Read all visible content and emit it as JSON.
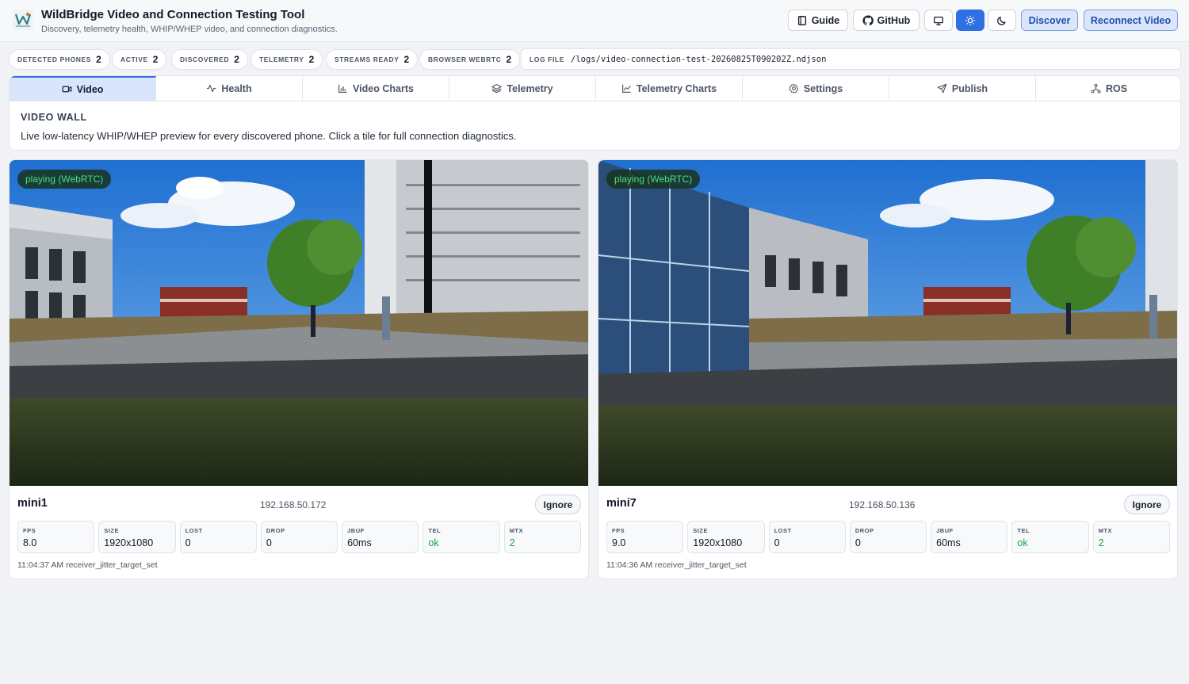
{
  "header": {
    "title": "WildBridge Video and Connection Testing Tool",
    "subtitle": "Discovery, telemetry health, WHIP/WHEP video, and connection diagnostics.",
    "logo_icon": "wildbridge-logo-icon",
    "buttons": {
      "guide": "Guide",
      "github": "GitHub",
      "discover": "Discover",
      "reconnect": "Reconnect Video"
    },
    "theme_icons": [
      "monitor-icon",
      "sun-icon",
      "moon-icon"
    ],
    "active_theme": "light",
    "accent": "#2f6fe4"
  },
  "stats": [
    {
      "label": "DETECTED PHONES",
      "value": "2"
    },
    {
      "label": "ACTIVE",
      "value": "2"
    },
    {
      "label": "DISCOVERED",
      "value": "2"
    },
    {
      "label": "TELEMETRY",
      "value": "2"
    },
    {
      "label": "STREAMS READY",
      "value": "2"
    },
    {
      "label": "BROWSER WEBRTC",
      "value": "2"
    }
  ],
  "logfile": {
    "label": "LOG FILE",
    "path": "/logs/video-connection-test-20260825T090202Z.ndjson"
  },
  "tabs": [
    {
      "label": "Video",
      "icon": "video-icon",
      "active": true
    },
    {
      "label": "Health",
      "icon": "activity-icon",
      "active": false
    },
    {
      "label": "Video Charts",
      "icon": "bar-chart-icon",
      "active": false
    },
    {
      "label": "Telemetry",
      "icon": "layers-icon",
      "active": false
    },
    {
      "label": "Telemetry Charts",
      "icon": "line-chart-icon",
      "active": false
    },
    {
      "label": "Settings",
      "icon": "gear-icon",
      "active": false
    },
    {
      "label": "Publish",
      "icon": "send-icon",
      "active": false
    },
    {
      "label": "ROS",
      "icon": "network-icon",
      "active": false
    }
  ],
  "wall": {
    "title": "VIDEO WALL",
    "description": "Live low-latency WHIP/WHEP preview for every discovered phone. Click a tile for full connection diagnostics."
  },
  "devices": [
    {
      "name": "mini1",
      "ip": "192.168.50.172",
      "status": "playing (WebRTC)",
      "ignore": "Ignore",
      "metrics": [
        {
          "key": "FPS",
          "value": "8.0"
        },
        {
          "key": "SIZE",
          "value": "1920x1080"
        },
        {
          "key": "LOST",
          "value": "0"
        },
        {
          "key": "DROP",
          "value": "0"
        },
        {
          "key": "JBUF",
          "value": "60ms"
        },
        {
          "key": "TEL",
          "value": "ok"
        },
        {
          "key": "MTX",
          "value": "2"
        }
      ],
      "last_event": "11:04:37 AM receiver_jitter_target_set"
    },
    {
      "name": "mini7",
      "ip": "192.168.50.136",
      "status": "playing (WebRTC)",
      "ignore": "Ignore",
      "metrics": [
        {
          "key": "FPS",
          "value": "9.0"
        },
        {
          "key": "SIZE",
          "value": "1920x1080"
        },
        {
          "key": "LOST",
          "value": "0"
        },
        {
          "key": "DROP",
          "value": "0"
        },
        {
          "key": "JBUF",
          "value": "60ms"
        },
        {
          "key": "TEL",
          "value": "ok"
        },
        {
          "key": "MTX",
          "value": "2"
        }
      ],
      "last_event": "11:04:36 AM receiver_jitter_target_set"
    }
  ]
}
